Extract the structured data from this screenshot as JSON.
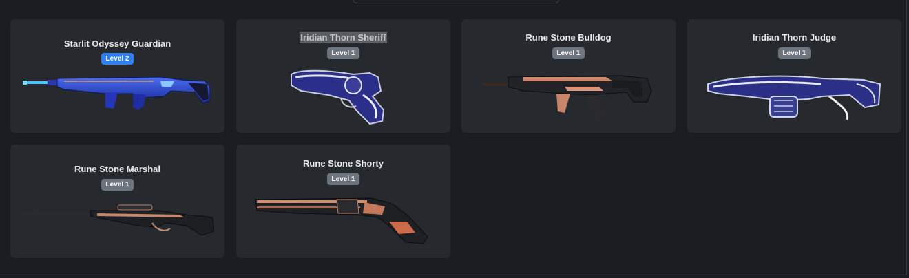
{
  "colors": {
    "page_bg": "#1a1d21",
    "card_bg": "#26292e",
    "badge_default": "#6c757d",
    "badge_active": "#2f7ff0"
  },
  "cards": [
    {
      "name": "Starlit Odyssey Guardian",
      "level": "Level 2",
      "badge_color": "blue",
      "weapon_icon": "guardian-rifle-icon"
    },
    {
      "name": "Iridian Thorn Sheriff",
      "level": "Level 1",
      "badge_color": "gray",
      "weapon_icon": "sheriff-pistol-icon",
      "selected_text": true
    },
    {
      "name": "Rune Stone Bulldog",
      "level": "Level 1",
      "badge_color": "gray",
      "weapon_icon": "bulldog-rifle-icon"
    },
    {
      "name": "Iridian Thorn Judge",
      "level": "Level 1",
      "badge_color": "gray",
      "weapon_icon": "judge-shotgun-icon"
    },
    {
      "name": "Rune Stone Marshal",
      "level": "Level 1",
      "badge_color": "gray",
      "weapon_icon": "marshal-sniper-icon"
    },
    {
      "name": "Rune Stone Shorty",
      "level": "Level 1",
      "badge_color": "gray",
      "weapon_icon": "shorty-shotgun-icon"
    }
  ]
}
